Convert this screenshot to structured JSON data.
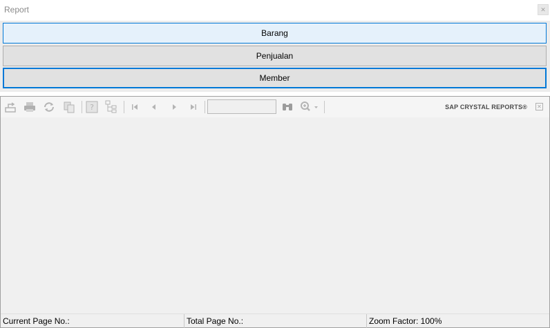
{
  "window": {
    "title": "Report",
    "close_glyph": "✕"
  },
  "report_buttons": [
    {
      "label": "Barang"
    },
    {
      "label": "Penjualan"
    },
    {
      "label": "Member"
    }
  ],
  "toolbar": {
    "icons": [
      "export-icon",
      "print-icon",
      "refresh-icon",
      "copy-icon",
      "help-icon",
      "group-tree-icon",
      "first-page-icon",
      "prev-page-icon",
      "next-page-icon",
      "last-page-icon",
      "find-icon",
      "zoom-icon"
    ],
    "page_input_value": "",
    "brand": "SAP CRYSTAL REPORTS®",
    "close_glyph": "✕"
  },
  "statusbar": {
    "current_page": "Current Page No.:",
    "total_page": "Total Page No.:",
    "zoom": "Zoom Factor: 100%"
  }
}
